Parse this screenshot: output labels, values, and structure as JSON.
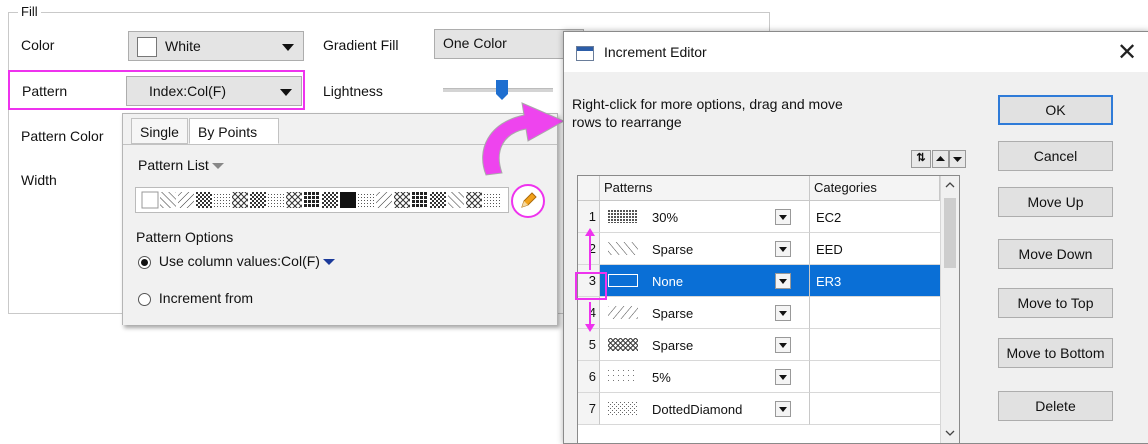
{
  "fill": {
    "group_title": "Fill",
    "color_label": "Color",
    "color_value": "White",
    "gradient_label": "Gradient Fill",
    "gradient_value": "One Color",
    "pattern_label": "Pattern",
    "pattern_value": "Index:Col(F)",
    "lightness_label": "Lightness",
    "pattern_color_label": "Pattern Color",
    "width_label": "Width",
    "lightness_fraction": 0.5
  },
  "panel": {
    "tabs": [
      "Single",
      "By Points"
    ],
    "pattern_list_label": "Pattern List",
    "pattern_options_label": "Pattern Options",
    "option_column": "Use column values:Col(F)",
    "option_increment": "Increment from"
  },
  "editor": {
    "title": "Increment Editor",
    "instructions_line1": "Right-click for more options, drag and move",
    "instructions_line2": "rows to  rearrange",
    "headers": {
      "patterns": "Patterns",
      "categories": "Categories"
    },
    "rows": [
      {
        "num": "1",
        "pattern": "30%",
        "category": "EC2"
      },
      {
        "num": "2",
        "pattern": "Sparse",
        "category": "EED"
      },
      {
        "num": "3",
        "pattern": "None",
        "category": "ER3"
      },
      {
        "num": "4",
        "pattern": "Sparse",
        "category": ""
      },
      {
        "num": "5",
        "pattern": "Sparse",
        "category": ""
      },
      {
        "num": "6",
        "pattern": "5%",
        "category": ""
      },
      {
        "num": "7",
        "pattern": "DottedDiamond",
        "category": ""
      }
    ],
    "selected_row": "3",
    "buttons": {
      "ok": "OK",
      "cancel": "Cancel",
      "move_up": "Move Up",
      "move_down": "Move Down",
      "move_top": "Move to Top",
      "move_bottom": "Move to Bottom",
      "delete": "Delete"
    }
  },
  "colors": {
    "highlight_magenta": "#ee33ee",
    "selection_blue": "#0a6fd6",
    "ok_border": "#2f7bd8"
  },
  "icons": [
    "pencil-icon",
    "curved-arrow-icon",
    "sort-icon",
    "scroll-up-icon",
    "scroll-down-icon",
    "close-icon",
    "drag-arrow-icon"
  ]
}
